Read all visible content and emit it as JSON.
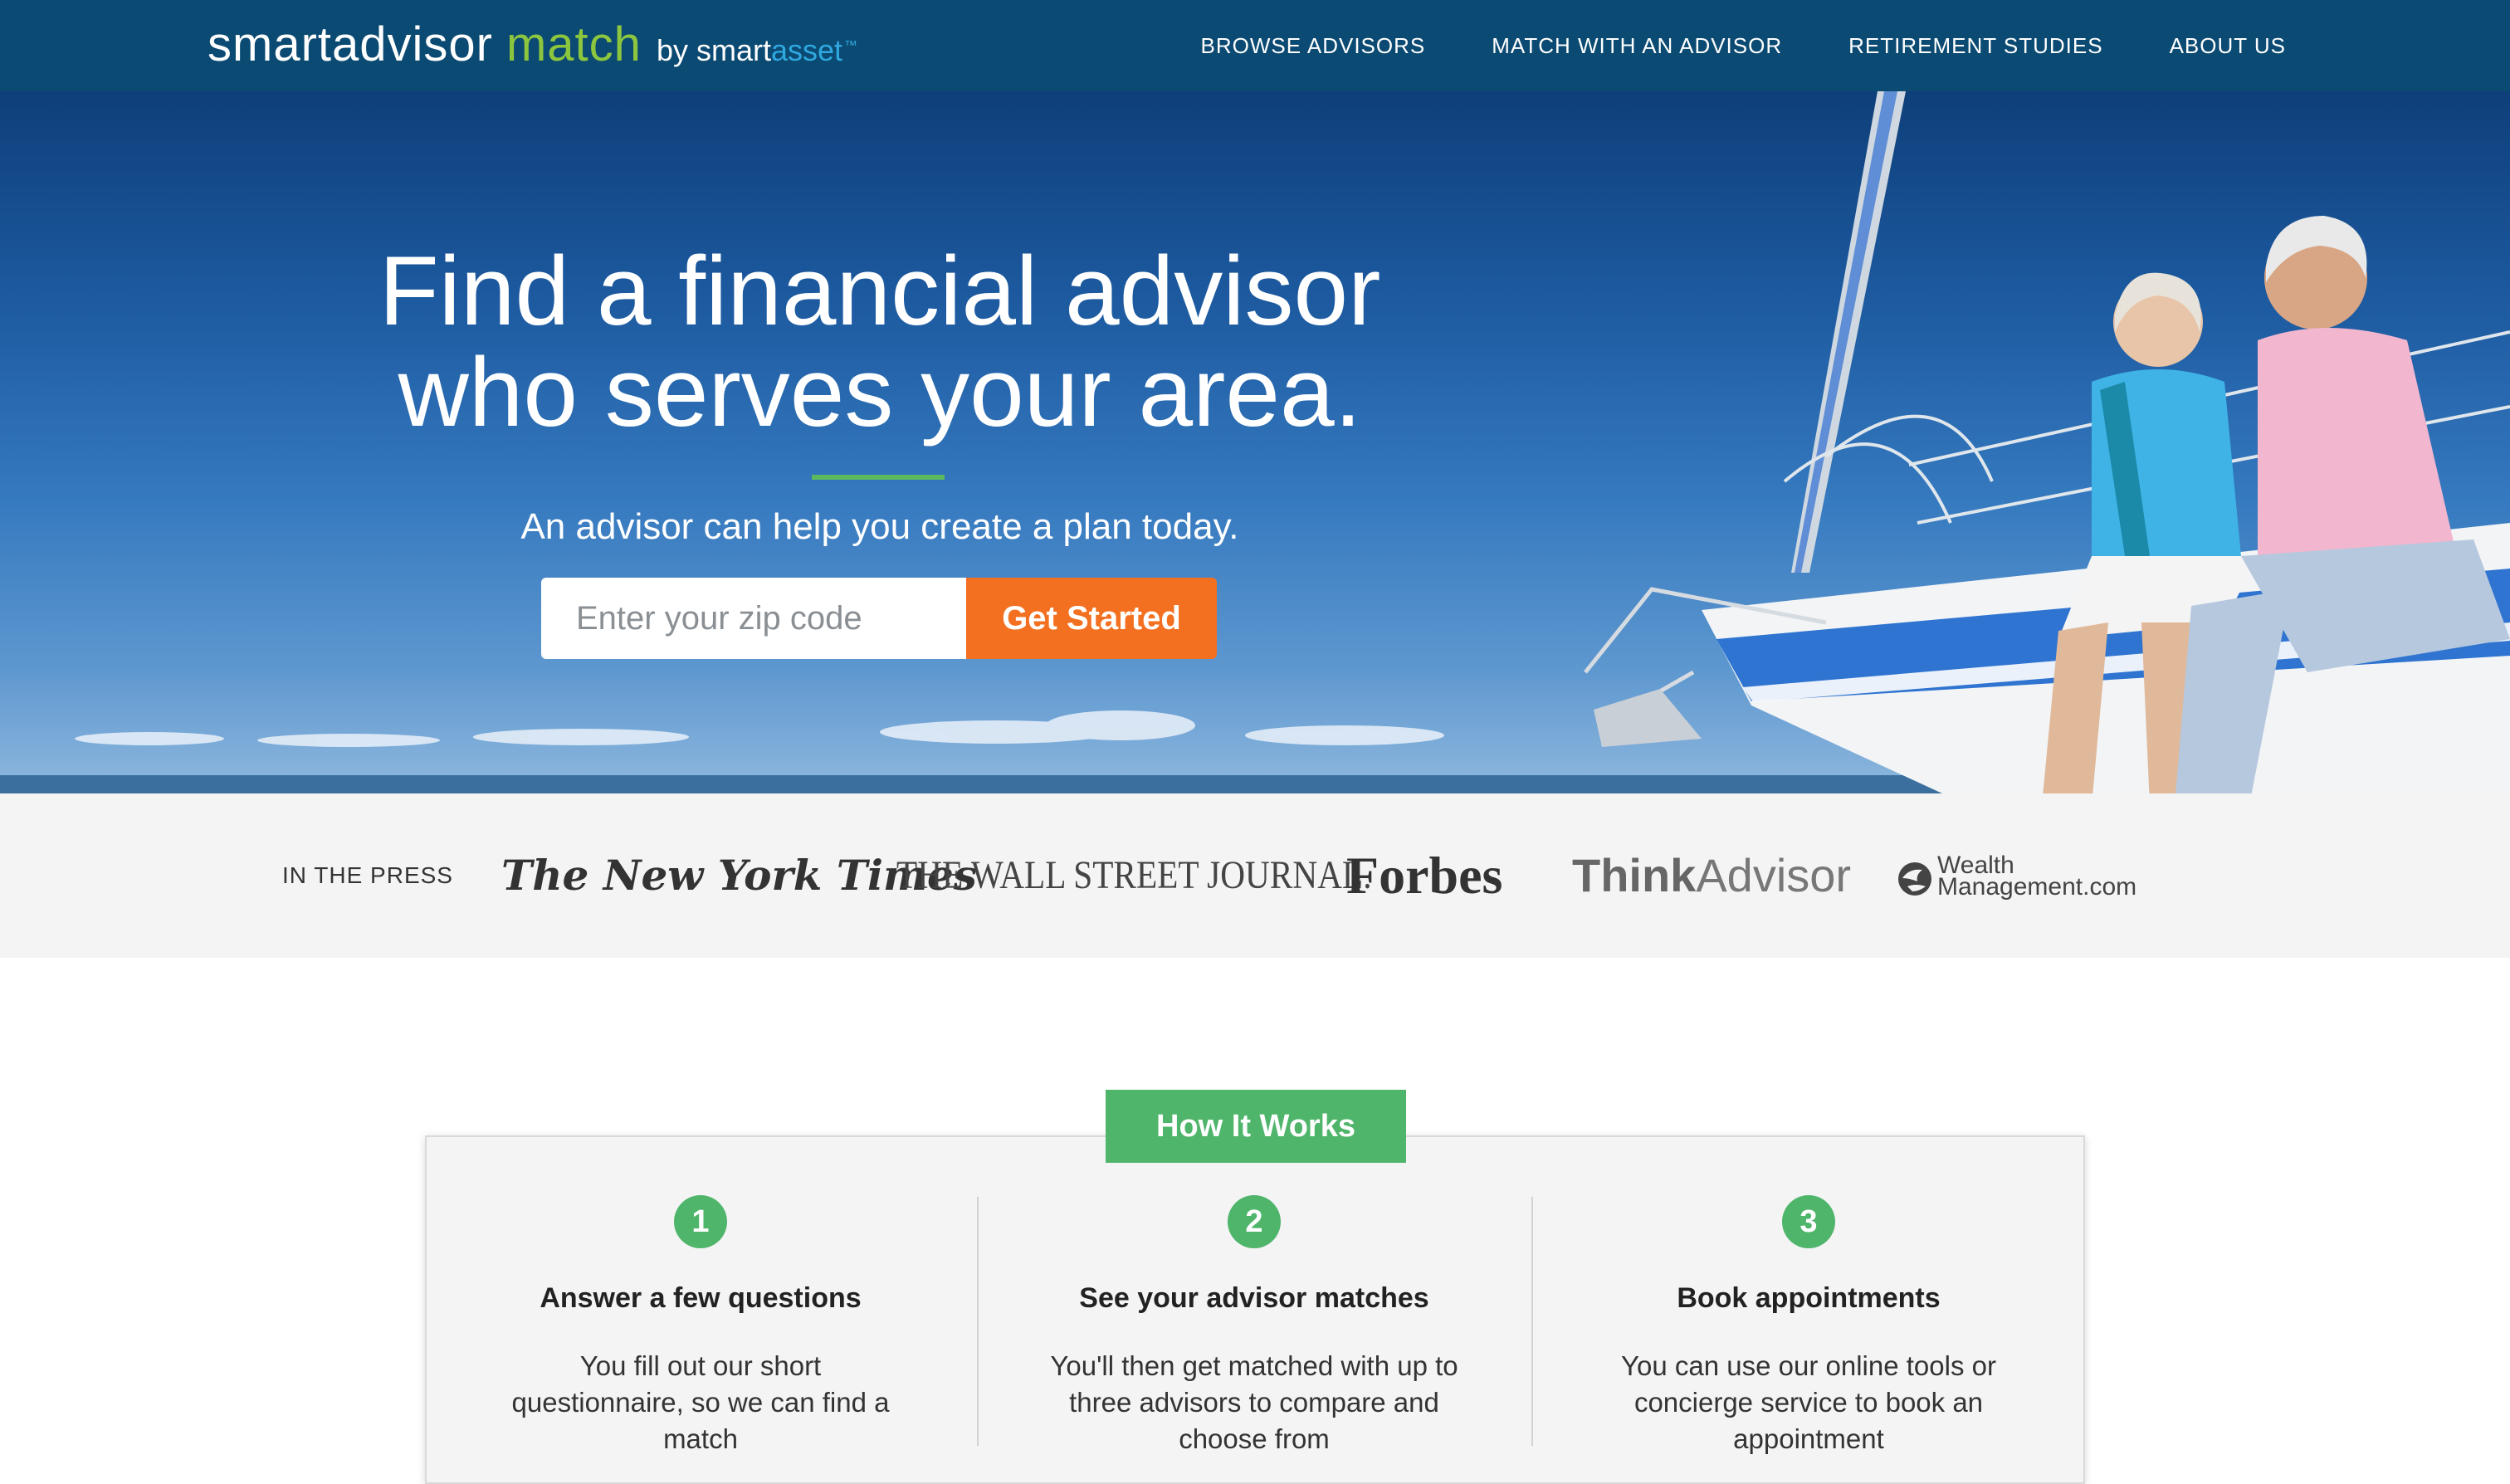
{
  "header": {
    "logo": {
      "smart": "smartadvisor",
      "match": "match",
      "by": "by",
      "smart2": "smart",
      "asset": "asset",
      "tm": "™"
    },
    "nav": [
      "BROWSE ADVISORS",
      "MATCH WITH AN ADVISOR",
      "RETIREMENT STUDIES",
      "ABOUT US"
    ]
  },
  "hero": {
    "title_line1": "Find a financial advisor",
    "title_line2": "who serves your area.",
    "subtitle": "An advisor can help you create a plan today.",
    "zip_placeholder": "Enter your zip code",
    "zip_value": "",
    "cta_label": "Get Started"
  },
  "press": {
    "label": "IN THE PRESS",
    "logos": {
      "nyt": "The New York Times",
      "wsj": "THE WALL STREET JOURNAL.",
      "forbes": "Forbes",
      "think_bold": "Think",
      "think_rest": "Advisor",
      "wm_line1": "Wealth",
      "wm_line2": "Management.com"
    }
  },
  "how_it_works": {
    "title": "How It Works",
    "steps": [
      {
        "number": "1",
        "title": "Answer a few questions",
        "desc": "You fill out our short questionnaire, so we can find a match"
      },
      {
        "number": "2",
        "title": "See your advisor matches",
        "desc": "You'll then get matched with up to three advisors to compare and choose from"
      },
      {
        "number": "3",
        "title": "Book appointments",
        "desc": "You can use our online tools or concierge service to book an appointment"
      }
    ]
  },
  "colors": {
    "nav_bg": "#0b4a72",
    "accent_green": "#4fb56b",
    "logo_green": "#8cc63f",
    "cta_orange": "#f37021",
    "press_bg": "#f4f4f5"
  }
}
